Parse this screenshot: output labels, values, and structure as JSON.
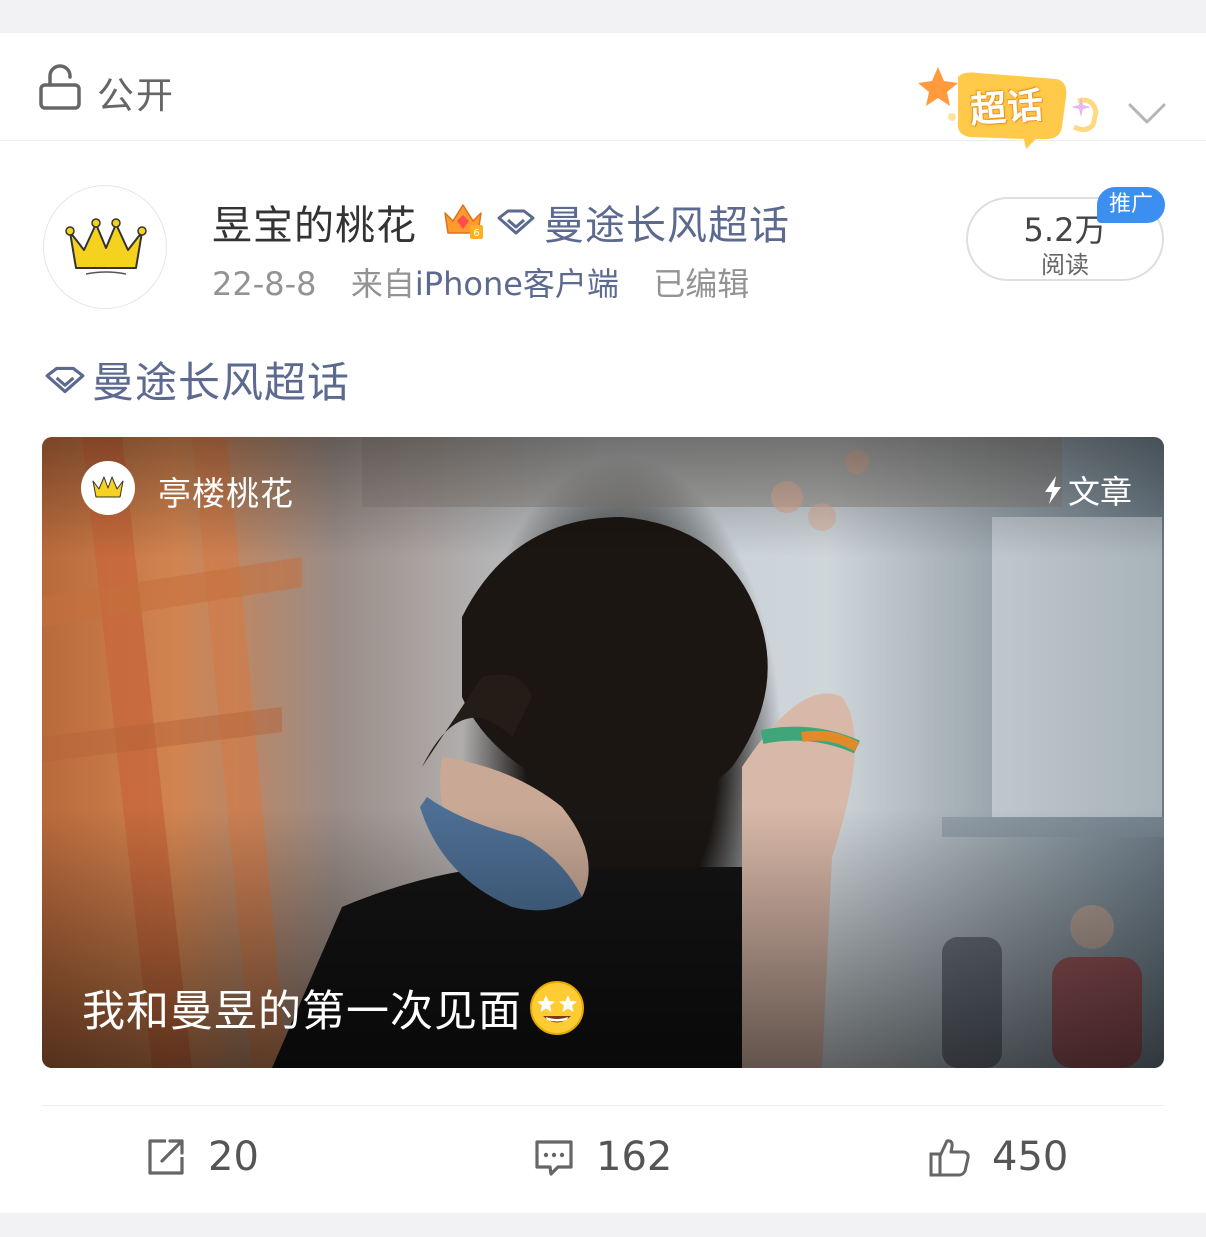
{
  "visibility": {
    "label": "公开",
    "icon": "lock-open-icon"
  },
  "chaohua_badge": {
    "label": "超话"
  },
  "post": {
    "username": "昱宝的桃花",
    "topic_label": "曼途长风超话",
    "date": "22-8-8",
    "source_prefix": "来自",
    "source": "iPhone客户端",
    "edited": "已编辑",
    "reads": {
      "count": "5.2万",
      "label": "阅读"
    },
    "promo_tag": "推广",
    "body_topic": "曼途长风超话"
  },
  "article": {
    "author": "亭楼桃花",
    "type_label": "文章",
    "title": "我和曼昱的第一次见面"
  },
  "actions": {
    "repost": "20",
    "comment": "162",
    "like": "450"
  },
  "colors": {
    "link": "#5d6a90",
    "promo": "#3b8ff0",
    "text": "#333333"
  }
}
